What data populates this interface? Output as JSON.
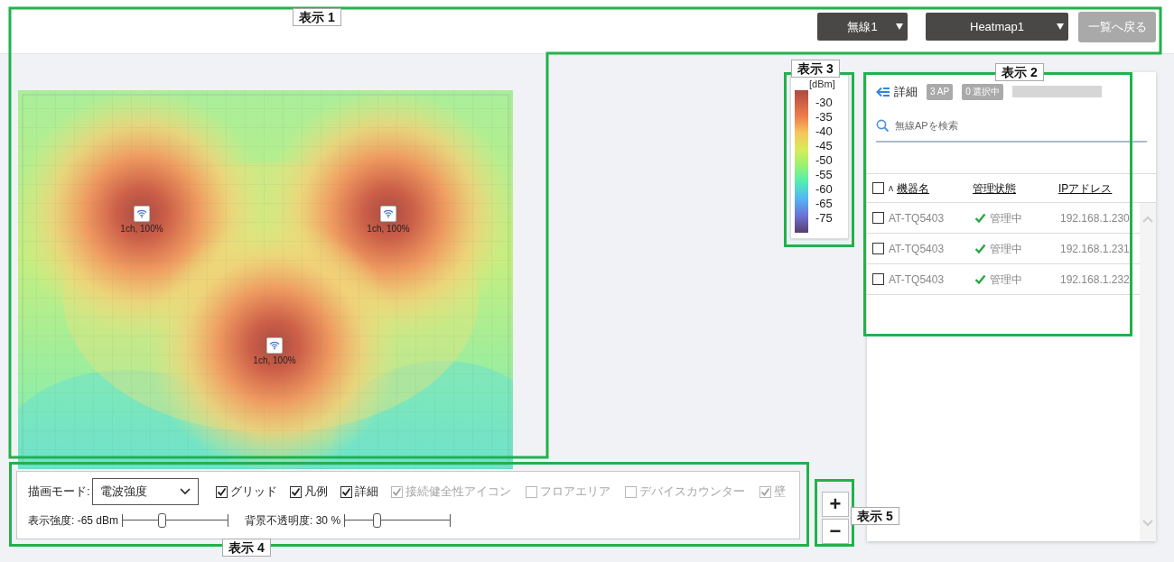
{
  "toolbar": {
    "radio_select": "無線1",
    "heatmap_select": "Heatmap1",
    "back_button": "一覧へ戻る"
  },
  "heatmap": {
    "access_points": [
      {
        "label": "1ch, 100%"
      },
      {
        "label": "1ch, 100%"
      },
      {
        "label": "1ch, 100%"
      }
    ]
  },
  "legend": {
    "unit": "[dBm]",
    "ticks": [
      "-30",
      "-35",
      "-40",
      "-45",
      "-50",
      "-55",
      "-60",
      "-65",
      "-75"
    ]
  },
  "panel": {
    "title": "詳細",
    "ap_count": "3 AP",
    "selected_count": "0 選択中",
    "search_placeholder": "無線APを検索",
    "header_checked": false,
    "sort_indicator": "ʌ",
    "columns": [
      "機器名",
      "管理状態",
      "IPアドレス"
    ],
    "rows": [
      {
        "checked": false,
        "name": "AT-TQ5403",
        "status": "管理中",
        "ip": "192.168.1.230"
      },
      {
        "checked": false,
        "name": "AT-TQ5403",
        "status": "管理中",
        "ip": "192.168.1.231"
      },
      {
        "checked": false,
        "name": "AT-TQ5403",
        "status": "管理中",
        "ip": "192.168.1.232"
      }
    ]
  },
  "controls": {
    "mode_label": "描画モード:",
    "mode_value": "電波強度",
    "checkboxes": [
      {
        "label": "グリッド",
        "checked": true,
        "disabled": false
      },
      {
        "label": "凡例",
        "checked": true,
        "disabled": false
      },
      {
        "label": "詳細",
        "checked": true,
        "disabled": false
      },
      {
        "label": "接続健全性アイコン",
        "checked": true,
        "disabled": true
      },
      {
        "label": "フロアエリア",
        "checked": false,
        "disabled": true
      },
      {
        "label": "デバイスカウンター",
        "checked": false,
        "disabled": true
      },
      {
        "label": "壁",
        "checked": true,
        "disabled": true
      }
    ],
    "sliders": [
      {
        "label": "表示強度: -65 dBm",
        "level": 0.36
      },
      {
        "label": "背景不透明度: 30 %",
        "level": 0.3
      }
    ]
  },
  "zoom_buttons": [
    "+",
    "−"
  ],
  "callouts": [
    {
      "label": "表示 1"
    },
    {
      "label": "表示 2"
    },
    {
      "label": "表示 3"
    },
    {
      "label": "表示 4"
    },
    {
      "label": "表示 5"
    }
  ]
}
